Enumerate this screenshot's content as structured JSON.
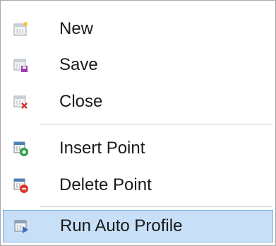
{
  "menu": {
    "items": [
      {
        "label": "New",
        "icon": "calendar-new-icon"
      },
      {
        "label": "Save",
        "icon": "calendar-save-icon"
      },
      {
        "label": "Close",
        "icon": "calendar-close-icon"
      },
      {
        "label": "Insert Point",
        "icon": "calendar-insert-icon"
      },
      {
        "label": "Delete Point",
        "icon": "calendar-delete-icon"
      },
      {
        "label": "Run Auto Profile",
        "icon": "calendar-run-icon",
        "highlighted": true
      }
    ]
  },
  "colors": {
    "highlight_bg": "#c8e0f7",
    "highlight_border": "#7fb2e5",
    "add_green": "#2e9e47",
    "delete_red": "#d9382b",
    "close_red": "#d32f2f",
    "save_purple": "#9b3fb0",
    "run_blue": "#3a6fb5"
  }
}
